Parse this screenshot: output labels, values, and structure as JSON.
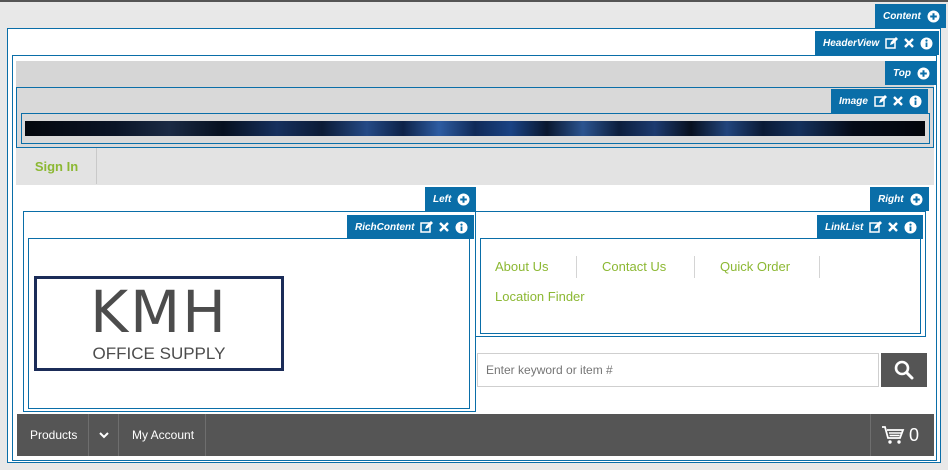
{
  "zones": {
    "content": "Content",
    "header_view": "HeaderView",
    "top": "Top",
    "image": "Image",
    "left": "Left",
    "right": "Right",
    "rich_content": "RichContent",
    "link_list": "LinkList"
  },
  "header": {
    "sign_in": "Sign In"
  },
  "logo": {
    "main": "KMH",
    "sub": "OFFICE SUPPLY"
  },
  "link_list": {
    "items": [
      "About Us",
      "Contact Us",
      "Quick Order",
      "Location Finder"
    ]
  },
  "search": {
    "placeholder": "Enter keyword or item #"
  },
  "nav": {
    "products": "Products",
    "my_account": "My Account",
    "cart_count": "0"
  },
  "colors": {
    "accent": "#0a6ea8",
    "link_green": "#8cb833",
    "nav_bg": "#555555"
  },
  "icons": [
    "plus-circle-icon",
    "edit-icon",
    "close-icon",
    "info-icon",
    "search-icon",
    "chevron-down-icon",
    "cart-icon"
  ]
}
